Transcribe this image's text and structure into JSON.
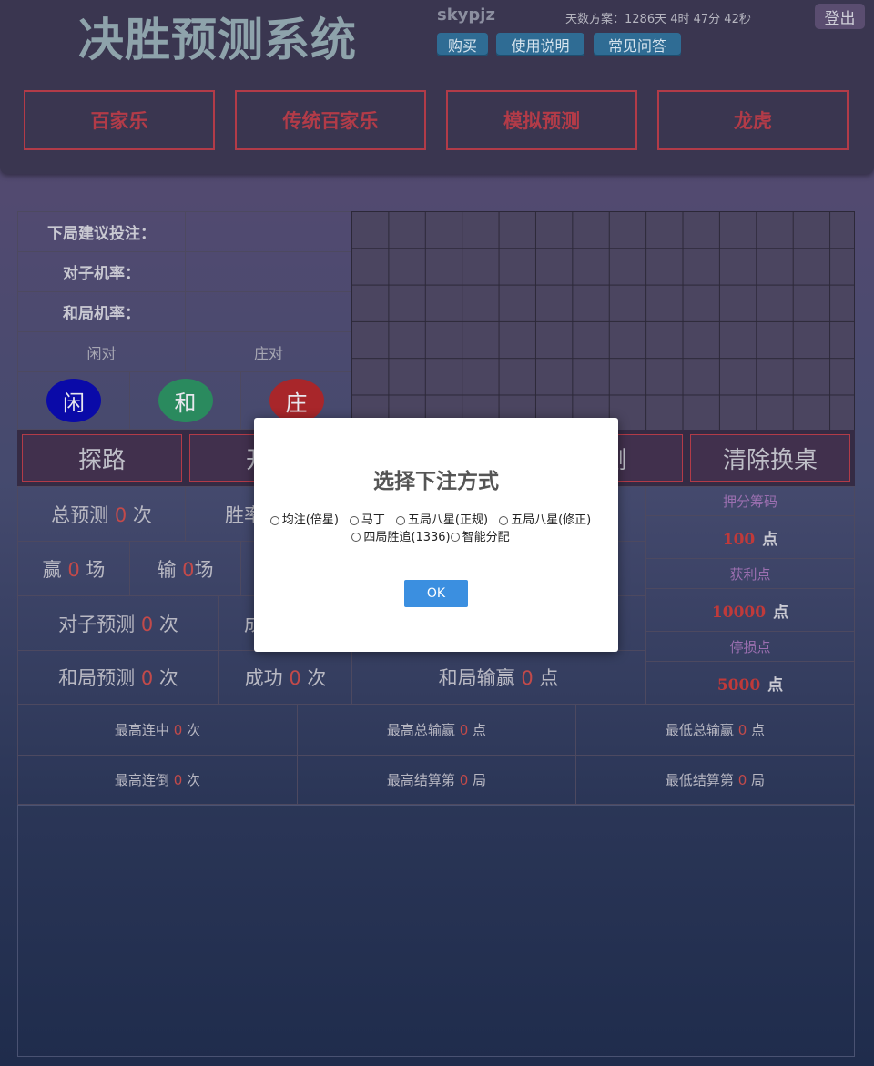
{
  "header": {
    "title": "决胜预测系统",
    "username": "skypjz",
    "plan_info": "天数方案：1286天 4时 47分 42秒",
    "logout_label": "登出",
    "nav": [
      {
        "label": "购买"
      },
      {
        "label": "使用说明"
      },
      {
        "label": "常见问答"
      }
    ],
    "modes": [
      {
        "label": "百家乐"
      },
      {
        "label": "传统百家乐"
      },
      {
        "label": "模拟预测"
      },
      {
        "label": "龙虎"
      }
    ]
  },
  "info": {
    "next_bet_label": "下局建议投注：",
    "pair_prob_label": "对子机率：",
    "tie_prob_label": "和局机率：",
    "player_pair": "闲对",
    "banker_pair": "庄对",
    "chips": [
      {
        "label": "闲",
        "color": "#0a0aa8"
      },
      {
        "label": "和",
        "color": "#2a8a5e"
      },
      {
        "label": "庄",
        "color": "#a8262a"
      }
    ]
  },
  "actions": {
    "probe": "探路",
    "start": "开始",
    "predict": "预测",
    "clear": "清除换桌"
  },
  "stats": {
    "total_prefix": "总预测",
    "total_value": "0",
    "total_suffix": "次",
    "winrate_prefix": "胜率",
    "win_prefix": "赢",
    "win_value": "0",
    "win_suffix": "场",
    "lose_prefix": "输",
    "lose_value": "0",
    "lose_suffix": "场",
    "pair_prefix": "对子预测",
    "pair_value": "0",
    "pair_suffix": "次",
    "pair_success_prefix": "成",
    "tie_prefix": "和局预测",
    "tie_value": "0",
    "tie_suffix": "次",
    "tie_success_prefix": "成功",
    "tie_success_value": "0",
    "tie_success_suffix": "次",
    "tie_pnl_prefix": "和局输赢",
    "tie_pnl_value": "0",
    "tie_pnl_suffix": "点"
  },
  "side": {
    "stake_label": "押分筹码",
    "stake_value": "100",
    "profit_label": "获利点",
    "profit_value": "10000",
    "stop_label": "停损点",
    "stop_value": "5000",
    "unit": "点"
  },
  "records": {
    "max_streak_win": {
      "prefix": "最高连中",
      "value": "0",
      "suffix": "次"
    },
    "max_total_win": {
      "prefix": "最高总输赢",
      "value": "0",
      "suffix": "点"
    },
    "min_total_win": {
      "prefix": "最低总输赢",
      "value": "0",
      "suffix": "点"
    },
    "max_streak_lose": {
      "prefix": "最高连倒",
      "value": "0",
      "suffix": "次"
    },
    "max_settle": {
      "prefix": "最高结算第",
      "value": "0",
      "suffix": "局"
    },
    "min_settle": {
      "prefix": "最低结算第",
      "value": "0",
      "suffix": "局"
    }
  },
  "modal": {
    "title": "选择下注方式",
    "options": [
      "均注(倍星)",
      "马丁",
      "五局八星(正规)",
      "五局八星(修正)",
      "四局胜追(1336)",
      "智能分配"
    ],
    "ok_label": "OK"
  }
}
